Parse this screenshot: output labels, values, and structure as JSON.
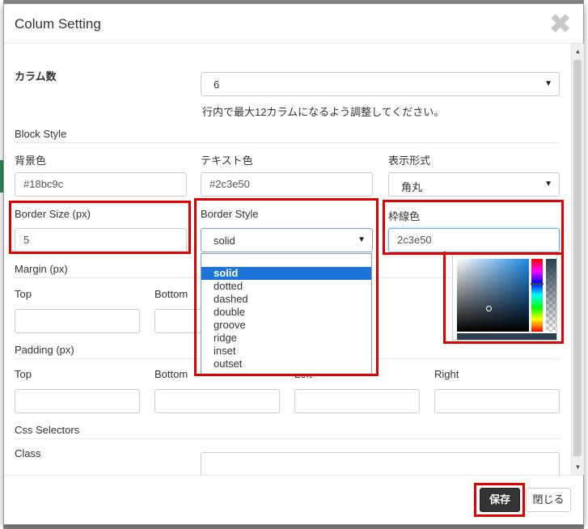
{
  "dialog": {
    "title": "Colum Setting",
    "close_glyph": "✖"
  },
  "columns": {
    "label": "カラム数",
    "value": "6",
    "help": "行内で最大12カラムになるよう調整してください。"
  },
  "block_style": {
    "section": "Block Style",
    "bg_color": {
      "label": "背景色",
      "value": "#18bc9c"
    },
    "text_color": {
      "label": "テキスト色",
      "value": "#2c3e50"
    },
    "display": {
      "label": "表示形式",
      "value": "角丸"
    },
    "border_size": {
      "label": "Border Size (px)",
      "value": "5"
    },
    "border_style": {
      "label": "Border Style",
      "value": "solid",
      "options": [
        "solid",
        "dotted",
        "dashed",
        "double",
        "groove",
        "ridge",
        "inset",
        "outset"
      ]
    },
    "border_color": {
      "label": "枠線色",
      "value": "2c3e50"
    }
  },
  "margin": {
    "section": "Margin (px)",
    "top": "Top",
    "bottom": "Bottom"
  },
  "padding": {
    "section": "Padding (px)",
    "top": "Top",
    "bottom": "Bottom",
    "left": "Left",
    "right": "Right"
  },
  "css": {
    "section": "Css Selectors",
    "class_label": "Class"
  },
  "footer": {
    "save": "保存",
    "close": "閉じる"
  },
  "colors": {
    "accent": "#e00000",
    "selected_option": "#1e73d6",
    "save_button": "#333333",
    "picker_preview": "#2c3e50"
  },
  "icons": {
    "close": "close-icon",
    "dropdown": "chevron-down-icon"
  }
}
